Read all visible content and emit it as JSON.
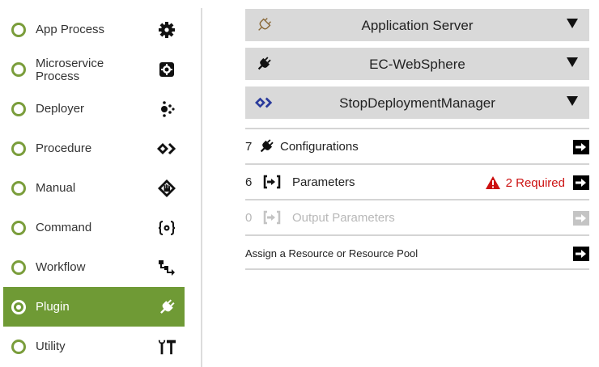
{
  "sidebar": {
    "items": [
      {
        "label": "App Process",
        "icon": "gear-icon"
      },
      {
        "label": "Microservice Process",
        "label_line1": "Microservice",
        "label_line2": "Process",
        "icon": "microservice-icon"
      },
      {
        "label": "Deployer",
        "icon": "dots-icon"
      },
      {
        "label": "Procedure",
        "icon": "procedure-icon"
      },
      {
        "label": "Manual",
        "icon": "hand-diamond-icon"
      },
      {
        "label": "Command",
        "icon": "braces-gear-icon"
      },
      {
        "label": "Workflow",
        "icon": "workflow-icon"
      },
      {
        "label": "Plugin",
        "icon": "plug-icon",
        "selected": true
      },
      {
        "label": "Utility",
        "icon": "tools-icon"
      }
    ],
    "selected_color": "#6f9a35"
  },
  "dropdowns": {
    "application": {
      "label": "Application Server",
      "icon": "plug-outline-icon"
    },
    "plugin": {
      "label": "EC-WebSphere",
      "icon": "plug-icon"
    },
    "procedure": {
      "label": "StopDeploymentManager",
      "icon": "procedure-icon",
      "icon_color": "#2a3b9c"
    }
  },
  "rows": {
    "configurations": {
      "count": "7",
      "label": "Configurations"
    },
    "parameters": {
      "count": "6",
      "label": "Parameters",
      "required_text": "2 Required"
    },
    "output_parameters": {
      "count": "0",
      "label": "Output Parameters",
      "disabled": true
    },
    "resource": {
      "label": "Assign a Resource or Resource Pool"
    }
  },
  "colors": {
    "required": "#cc1111",
    "dropdown_bg": "#d9d9d9"
  }
}
